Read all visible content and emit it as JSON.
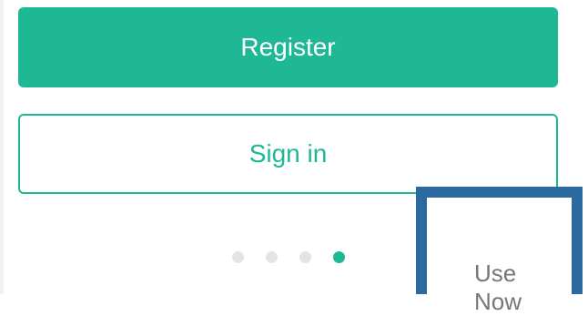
{
  "actions": {
    "register_label": "Register",
    "signin_label": "Sign in",
    "use_now_label": "Use Now"
  },
  "pager": {
    "total": 4,
    "active_index": 3
  },
  "colors": {
    "accent": "#1eb895",
    "highlight": "#2a6aa0",
    "inactive_dot": "#e3e5e4",
    "muted_text": "#777777"
  }
}
